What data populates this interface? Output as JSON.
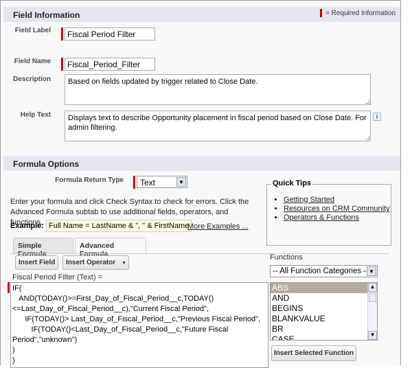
{
  "field_info": {
    "title": "Field Information",
    "required_legend": "= Required Information",
    "field_label": {
      "label": "Field Label",
      "value": "Fiscal Period Filter"
    },
    "field_name": {
      "label": "Field Name",
      "value": "Fiscal_Period_Filter"
    },
    "description": {
      "label": "Description",
      "value": "Based on fields updated by trigger related to Close Date."
    },
    "help_text": {
      "label": "Help Text",
      "value": "Displays text to describe Opportunity placement in fiscal period based on Close Date. For admin filtering.",
      "info_icon": "i"
    }
  },
  "formula_options": {
    "title": "Formula Options",
    "return_type_label": "Formula Return Type",
    "return_type_value": "Text",
    "instructions": "Enter your formula and click Check Syntax to check for errors. Click the Advanced Formula subtab to use additional fields, operators, and functions.",
    "example_label": "Example:",
    "example_value": "Full Name = LastName & \", \" & FirstName",
    "more_examples": "More Examples ...",
    "quick_tips": {
      "title": "Quick Tips",
      "links": [
        "Getting Started",
        "Resources on CRM Community",
        "Operators & Functions"
      ]
    },
    "tabs": [
      "Simple Formula",
      "Advanced Formula"
    ],
    "insert_field": "Insert Field",
    "insert_operator": "Insert Operator",
    "formula_label": "Fiscal Period Filter (Text) =",
    "formula": "IF(\n   AND(TODAY()>=First_Day_of_Fiscal_Period__c,TODAY()\n<=Last_Day_of_Fiscal_Period__c),\"Current Fiscal Period\",\n      IF(TODAY()> Last_Day_of_Fiscal_Period__c,\"Previous Fiscal Period\",\n         IF(TODAY()<Last_Day_of_Fiscal_Period__c,\"Future Fiscal\nPeriod\",\"unknown\")\n)\n)",
    "functions_label": "Functions",
    "category_value": "-- All Function Categories --",
    "functions": [
      "ABS",
      "AND",
      "BEGINS",
      "BLANKVALUE",
      "BR",
      "CASE"
    ],
    "insert_selected": "Insert Selected Function"
  }
}
